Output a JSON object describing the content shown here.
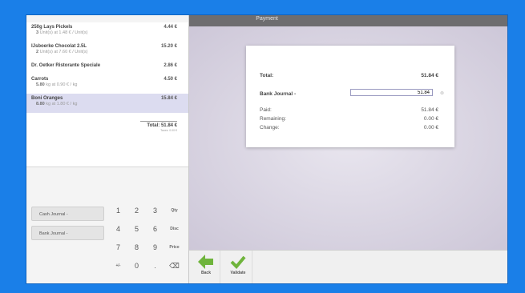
{
  "header": {
    "title": "Payment"
  },
  "orderlines": [
    {
      "name": "250g Lays Pickels",
      "qty": "3",
      "unit_info": "Unit(s) at 1.48 € / Unit(s)",
      "price": "4.44 €"
    },
    {
      "name": "IJsboerke Chocolat 2.5L",
      "qty": "2",
      "unit_info": "Unit(s) at 7.60 € / Unit(s)",
      "price": "15.20 €"
    },
    {
      "name": "Dr. Oetker Ristorante Speciale",
      "qty": "",
      "unit_info": "",
      "price": "2.86 €"
    },
    {
      "name": "Carrots",
      "qty": "5.80",
      "unit_info": "kg at 0.90 € / kg",
      "price": "4.50 €"
    },
    {
      "name": "Boni Oranges",
      "qty": "8.80",
      "unit_info": "kg at 1.80 € / kg",
      "price": "15.84 €"
    }
  ],
  "summary": {
    "total": "Total: 51.84 €",
    "taxes": "Taxes: 0.00 €"
  },
  "paymentmethods": [
    "Cash Journal -",
    "Bank Journal -"
  ],
  "numpad": [
    [
      "1",
      "2",
      "3",
      "Qty"
    ],
    [
      "4",
      "5",
      "6",
      "Disc"
    ],
    [
      "7",
      "8",
      "9",
      "Price"
    ],
    [
      "+/-",
      "0",
      ".",
      "⌫"
    ]
  ],
  "payment": {
    "total_label": "Total:",
    "total_value": "51.84 €",
    "journal_label": "Bank Journal -",
    "journal_input": "51.84",
    "paid_label": "Paid:",
    "paid_value": "51.84 €",
    "remaining_label": "Remaining:",
    "remaining_value": "0.00 €",
    "change_label": "Change:",
    "change_value": "0.00 €"
  },
  "actions": {
    "back": "Back",
    "validate": "Validate"
  },
  "colors": {
    "selected_row": "#dcdcf0",
    "back_arrow": "#6fb43c",
    "validate_check": "#6fb43c"
  }
}
